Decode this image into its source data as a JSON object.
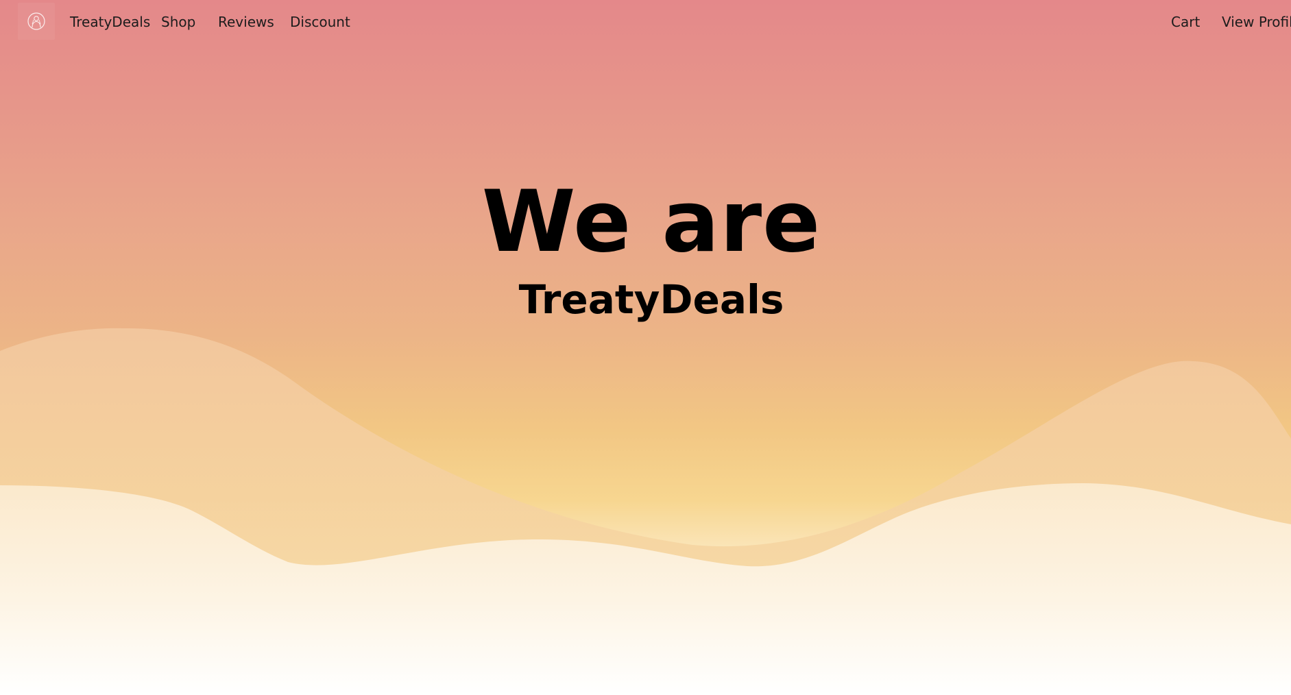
{
  "nav": {
    "brand": "TreatyDeals",
    "shop": "Shop",
    "reviews": "Reviews",
    "discount": "Discount",
    "cart": "Cart",
    "view_profile": "View Profile",
    "logo_icon": "logo-icon"
  },
  "hero": {
    "headline": "We are",
    "subheadline": "TreatyDeals"
  },
  "colors": {
    "gradient_top": "#e4888a",
    "gradient_mid": "#f2c784",
    "gradient_bottom": "#ffffff",
    "wave_back": "#f3cfa4",
    "wave_front": "#fbecd3",
    "text": "#000000"
  }
}
